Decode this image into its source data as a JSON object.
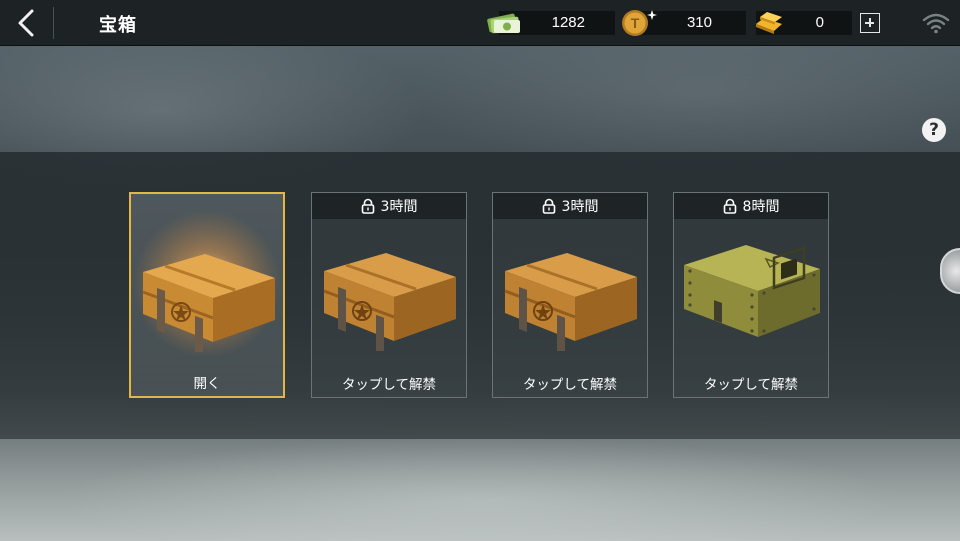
{
  "header": {
    "title": "宝箱",
    "currencies": [
      {
        "name": "cash",
        "value": "1282"
      },
      {
        "name": "t-coin",
        "value": "310"
      },
      {
        "name": "gold",
        "value": "0"
      }
    ]
  },
  "help": {
    "label": "?"
  },
  "chests": [
    {
      "type": "wooden",
      "lock": "",
      "label": "開く",
      "selected": true
    },
    {
      "type": "wooden",
      "lock": "3時間",
      "label": "タップして解禁",
      "selected": false
    },
    {
      "type": "wooden",
      "lock": "3時間",
      "label": "タップして解禁",
      "selected": false
    },
    {
      "type": "military-green",
      "lock": "8時間",
      "label": "タップして解禁",
      "selected": false
    }
  ],
  "icons": {
    "back": "chevron-left-icon",
    "cash": "cash-icon",
    "coin": "t-coin-icon",
    "gold": "gold-bar-icon",
    "add": "plus-icon",
    "wifi": "wifi-icon",
    "lock": "lock-icon"
  },
  "colors": {
    "selected_border": "#e3b64a",
    "topbar": "#1d2225"
  }
}
